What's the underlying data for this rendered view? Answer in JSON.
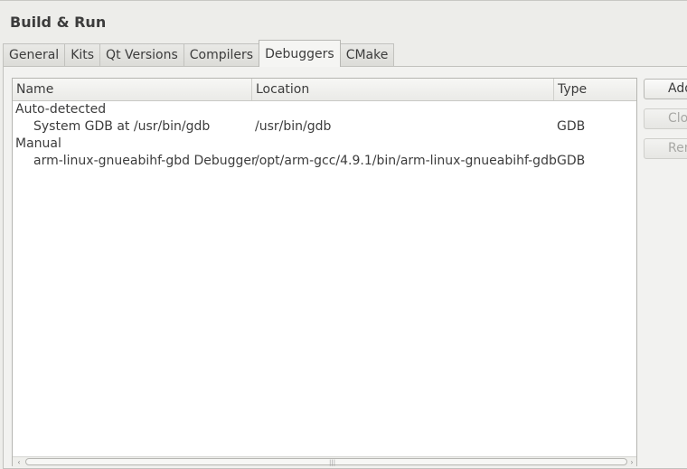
{
  "page": {
    "title": "Build & Run"
  },
  "tabs": [
    {
      "label": "General"
    },
    {
      "label": "Kits"
    },
    {
      "label": "Qt Versions"
    },
    {
      "label": "Compilers"
    },
    {
      "label": "Debuggers",
      "active": true
    },
    {
      "label": "CMake"
    }
  ],
  "table": {
    "columns": [
      "Name",
      "Location",
      "Type"
    ],
    "groups": [
      {
        "label": "Auto-detected",
        "rows": [
          {
            "name": "System GDB at /usr/bin/gdb",
            "location": "/usr/bin/gdb",
            "type": "GDB"
          }
        ]
      },
      {
        "label": "Manual",
        "rows": [
          {
            "name": "arm-linux-gnueabihf-gbd Debugger",
            "location": "/opt/arm-gcc/4.9.1/bin/arm-linux-gnueabihf-gdb",
            "type": "GDB"
          }
        ]
      }
    ]
  },
  "buttons": {
    "add": "Add",
    "clone": "Clone",
    "remove": "Remove"
  },
  "scrollbar": {
    "left_arrow": "‹",
    "right_arrow": "›",
    "grip": "|||"
  }
}
